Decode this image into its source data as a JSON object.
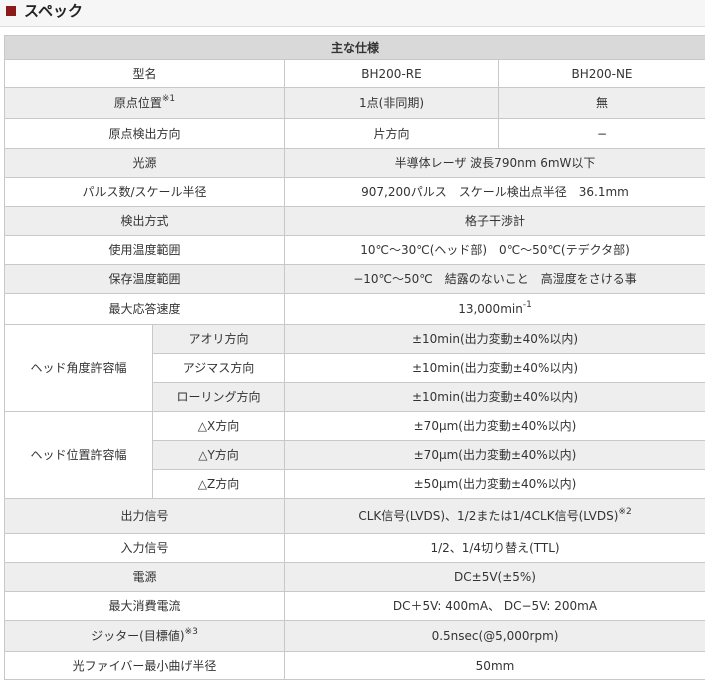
{
  "section": {
    "title": "スペック"
  },
  "table": {
    "caption": "主な仕様",
    "model_label": "型名",
    "models": [
      "BH200-RE",
      "BH200-NE"
    ],
    "origin": {
      "label": "原点位置",
      "note": "※1",
      "values": [
        "1点(非同期)",
        "無"
      ]
    },
    "origin_dir": {
      "label": "原点検出方向",
      "values": [
        "片方向",
        "−"
      ]
    },
    "light_source": {
      "label": "光源",
      "value": "半導体レーザ 波長790nm 6mW以下"
    },
    "pulses": {
      "label": "パルス数/スケール半径",
      "value": "907,200パルス　スケール検出点半径　36.1mm"
    },
    "detection": {
      "label": "検出方式",
      "value": "格子干渉計"
    },
    "op_temp": {
      "label": "使用温度範囲",
      "value": "10℃〜30℃(ヘッド部)　0℃〜50℃(テデクタ部)"
    },
    "storage_temp": {
      "label": "保存温度範囲",
      "value": "−10℃〜50℃　結露のないこと　高湿度をさける事"
    },
    "max_speed": {
      "label": "最大応答速度",
      "value": "13,000min",
      "exp": "-1"
    },
    "angle": {
      "label": "ヘッド角度許容幅",
      "items": [
        {
          "label": "アオリ方向",
          "value": "±10min(出力変動±40%以内)"
        },
        {
          "label": "アジマス方向",
          "value": "±10min(出力変動±40%以内)"
        },
        {
          "label": "ローリング方向",
          "value": "±10min(出力変動±40%以内)"
        }
      ]
    },
    "position": {
      "label": "ヘッド位置許容幅",
      "items": [
        {
          "label": "△X方向",
          "value": "±70μm(出力変動±40%以内)"
        },
        {
          "label": "△Y方向",
          "value": "±70μm(出力変動±40%以内)"
        },
        {
          "label": "△Z方向",
          "value": "±50μm(出力変動±40%以内)"
        }
      ]
    },
    "output": {
      "label": "出力信号",
      "value": "CLK信号(LVDS)、1/2または1/4CLK信号(LVDS)",
      "note": "※2"
    },
    "input": {
      "label": "入力信号",
      "value": "1/2、1/4切り替え(TTL)"
    },
    "power": {
      "label": "電源",
      "value": "DC±5V(±5%)"
    },
    "max_current": {
      "label": "最大消費電流",
      "value": "DC＋5V: 400mA、 DC−5V: 200mA"
    },
    "jitter": {
      "label": "ジッター(目標値)",
      "note": "※3",
      "value": "0.5nsec(@5,000rpm)"
    },
    "fiber": {
      "label": "光ファイバー最小曲げ半径",
      "value": "50mm"
    }
  }
}
